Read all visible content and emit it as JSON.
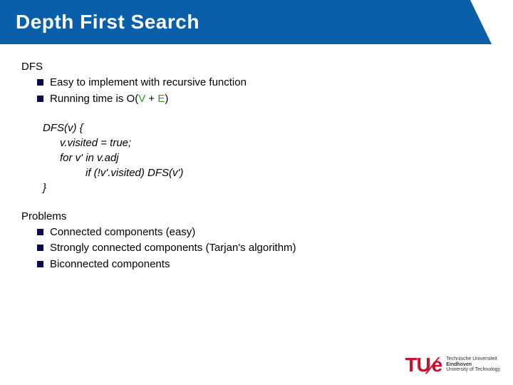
{
  "header": {
    "title": "Depth First Search"
  },
  "section1": {
    "title": "DFS",
    "bullets": [
      {
        "text": "Easy to implement with recursive function"
      },
      {
        "prefix": "Running time is O(",
        "v": "V",
        "mid": " + ",
        "e": "E",
        "suffix": ")"
      }
    ]
  },
  "code": {
    "l1": "DFS(v) {",
    "l2": "v.visited = true;",
    "l3": "for v' in v.adj",
    "l4": "if (!v'.visited) DFS(v')",
    "l5": "}"
  },
  "section2": {
    "title": "Problems",
    "bullets": [
      "Connected components (easy)",
      "Strongly connected components (Tarjan's algorithm)",
      "Biconnected components"
    ]
  },
  "logo": {
    "mark_t": "TU",
    "mark_e": "e",
    "line1": "Technische Universiteit",
    "line2": "Eindhoven",
    "line3": "University of Technology"
  }
}
